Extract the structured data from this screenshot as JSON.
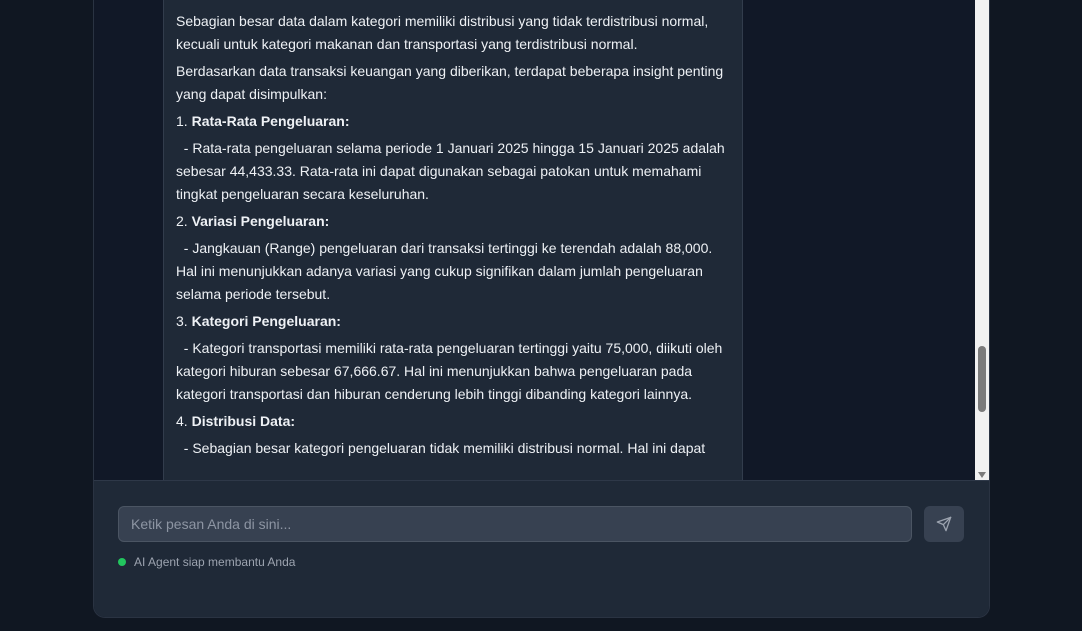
{
  "message": {
    "p1": "Sebagian besar data dalam kategori memiliki distribusi yang tidak terdistribusi normal, kecuali untuk kategori makanan dan transportasi yang terdistribusi normal.",
    "p2": "Berdasarkan data transaksi keuangan yang diberikan, terdapat beberapa insight penting yang dapat disimpulkan:",
    "items": [
      {
        "num": "1. ",
        "title": "Rata-Rata Pengeluaran:",
        "body": "- Rata-rata pengeluaran selama periode 1 Januari 2025 hingga 15 Januari 2025 adalah sebesar 44,433.33. Rata-rata ini dapat digunakan sebagai patokan untuk memahami tingkat pengeluaran secara keseluruhan."
      },
      {
        "num": "2. ",
        "title": "Variasi Pengeluaran:",
        "body": "- Jangkauan (Range) pengeluaran dari transaksi tertinggi ke terendah adalah 88,000. Hal ini menunjukkan adanya variasi yang cukup signifikan dalam jumlah pengeluaran selama periode tersebut."
      },
      {
        "num": "3. ",
        "title": "Kategori Pengeluaran:",
        "body": "- Kategori transportasi memiliki rata-rata pengeluaran tertinggi yaitu 75,000, diikuti oleh kategori hiburan sebesar 67,666.67. Hal ini menunjukkan bahwa pengeluaran pada kategori transportasi dan hiburan cenderung lebih tinggi dibanding kategori lainnya."
      },
      {
        "num": "4. ",
        "title": "Distribusi Data:",
        "body": "- Sebagian besar kategori pengeluaran tidak memiliki distribusi normal. Hal ini dapat"
      }
    ]
  },
  "composer": {
    "placeholder": "Ketik pesan Anda di sini...",
    "send_icon": "send-icon"
  },
  "status": {
    "text": "AI Agent siap membantu Anda",
    "dot_color": "#22c55e"
  }
}
